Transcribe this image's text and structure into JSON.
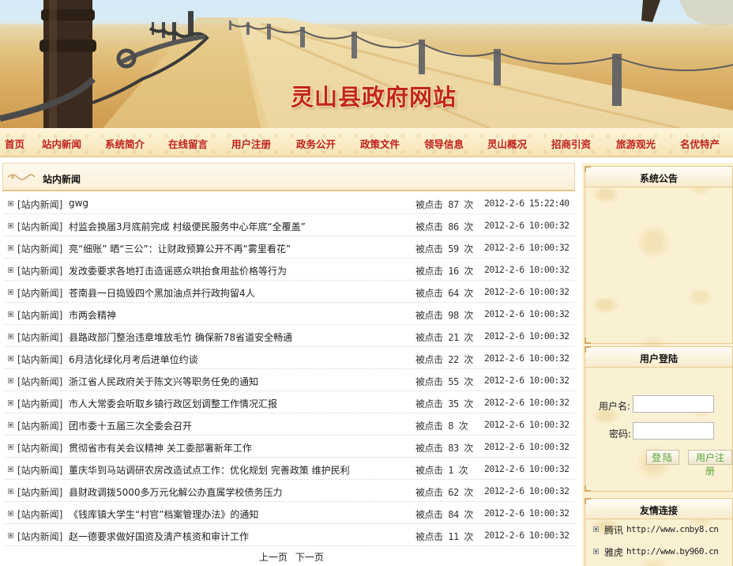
{
  "site": {
    "title": "灵山县政府网站"
  },
  "nav": [
    "首页",
    "站内新闻",
    "系统简介",
    "在线留言",
    "用户注册",
    "政务公开",
    "政策文件",
    "领导信息",
    "灵山概况",
    "招商引资",
    "旅游观光",
    "名优特产"
  ],
  "news": {
    "heading": "站内新闻",
    "rows": [
      {
        "tag": "[站内新闻]",
        "title": "gwg",
        "hits": "被点击 87 次",
        "time": "2012-2-6 15:22:40"
      },
      {
        "tag": "[站内新闻]",
        "title": "村监会换届3月底前完成 村级便民服务中心年底“全覆盖”",
        "hits": "被点击 86 次",
        "time": "2012-2-6 10:00:32"
      },
      {
        "tag": "[站内新闻]",
        "title": "亮“细账” 晒“三公”：让财政预算公开不再“雾里看花”",
        "hits": "被点击 59 次",
        "time": "2012-2-6 10:00:32"
      },
      {
        "tag": "[站内新闻]",
        "title": "发改委要求各地打击造谣惑众哄抬食用盐价格等行为",
        "hits": "被点击 16 次",
        "time": "2012-2-6 10:00:32"
      },
      {
        "tag": "[站内新闻]",
        "title": "苍南县一日捣毁四个黑加油点并行政拘留4人",
        "hits": "被点击 64 次",
        "time": "2012-2-6 10:00:32"
      },
      {
        "tag": "[站内新闻]",
        "title": "市两会精神",
        "hits": "被点击 98 次",
        "time": "2012-2-6 10:00:32"
      },
      {
        "tag": "[站内新闻]",
        "title": "县路政部门整治违章堆放毛竹 确保新78省道安全畅通",
        "hits": "被点击 21 次",
        "time": "2012-2-6 10:00:32"
      },
      {
        "tag": "[站内新闻]",
        "title": "6月洁化绿化月考后进单位约谈",
        "hits": "被点击 22 次",
        "time": "2012-2-6 10:00:32"
      },
      {
        "tag": "[站内新闻]",
        "title": "浙江省人民政府关于陈文兴等职务任免的通知",
        "hits": "被点击 55 次",
        "time": "2012-2-6 10:00:32"
      },
      {
        "tag": "[站内新闻]",
        "title": "市人大常委会听取乡镇行政区划调整工作情况汇报",
        "hits": "被点击 35 次",
        "time": "2012-2-6 10:00:32"
      },
      {
        "tag": "[站内新闻]",
        "title": "团市委十五届三次全委会召开",
        "hits": "被点击 8 次",
        "time": "2012-2-6 10:00:32"
      },
      {
        "tag": "[站内新闻]",
        "title": "贯彻省市有关会议精神 关工委部署新年工作",
        "hits": "被点击 83 次",
        "time": "2012-2-6 10:00:32"
      },
      {
        "tag": "[站内新闻]",
        "title": "董庆华到马站调研农房改造试点工作：优化规划 完善政策 维护民利",
        "hits": "被点击 1 次",
        "time": "2012-2-6 10:00:32"
      },
      {
        "tag": "[站内新闻]",
        "title": "县财政调拨5000多万元化解公办直属学校债务压力",
        "hits": "被点击 62 次",
        "time": "2012-2-6 10:00:32"
      },
      {
        "tag": "[站内新闻]",
        "title": "《钱库镇大学生“村官”档案管理办法》的通知",
        "hits": "被点击 84 次",
        "time": "2012-2-6 10:00:32"
      },
      {
        "tag": "[站内新闻]",
        "title": "赵一德要求做好国资及清产核资和审计工作",
        "hits": "被点击 11 次",
        "time": "2012-2-6 10:00:32"
      }
    ],
    "pager": {
      "prev": "上一页",
      "next": "下一页"
    }
  },
  "sidebar": {
    "notice": {
      "heading": "系统公告"
    },
    "login": {
      "heading": "用户登陆",
      "username_label": "用户名:",
      "password_label": "密码:",
      "username_value": "",
      "password_value": "",
      "login_button": "登陆",
      "register_button": "用户注册"
    },
    "links": {
      "heading": "友情连接",
      "items": [
        {
          "name": "腾讯",
          "url": "http://www.cnby8.cn"
        },
        {
          "name": "雅虎",
          "url": "http://www.by960.cn"
        }
      ]
    }
  },
  "colors": {
    "nav_text": "#c0201a",
    "title_red": "#c2261b",
    "button_green": "#5aa53b"
  }
}
